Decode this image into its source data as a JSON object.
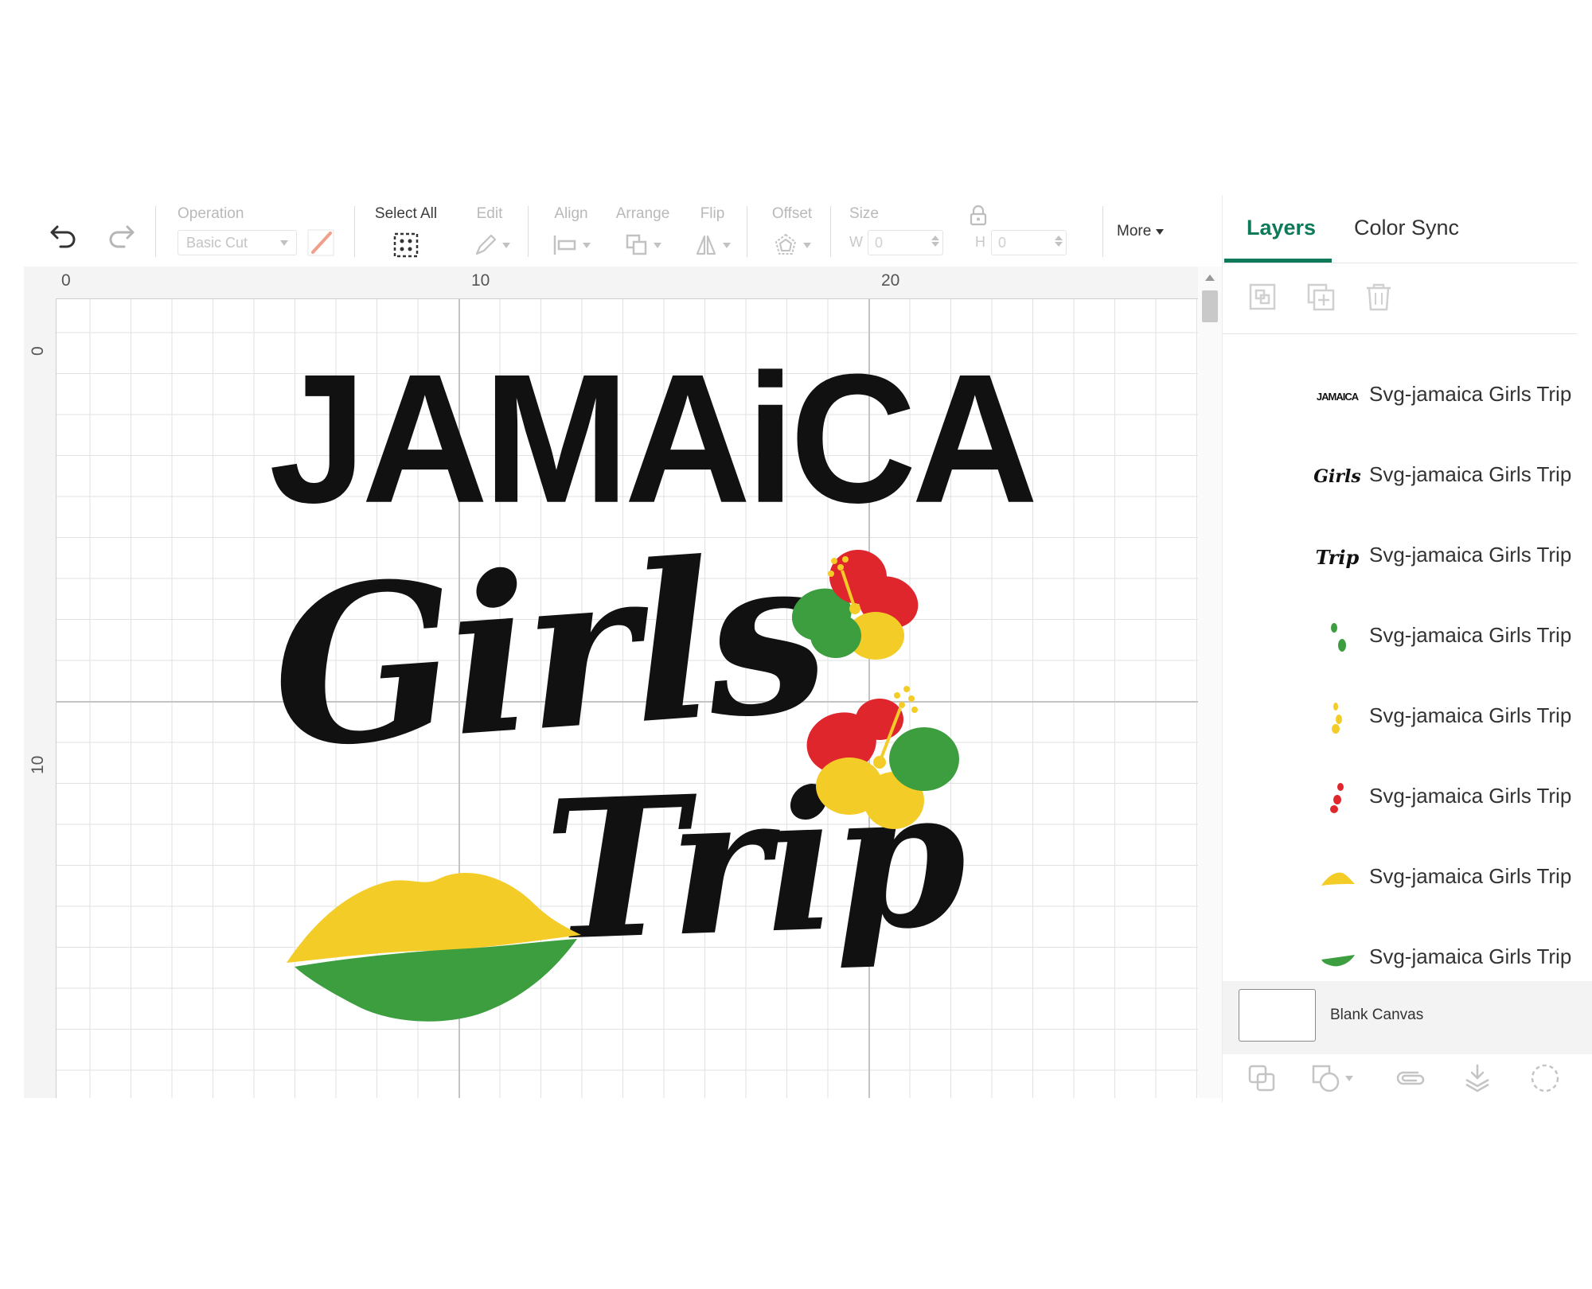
{
  "toolbar": {
    "undo_icon": "undo-icon",
    "redo_icon": "redo-icon",
    "operation": {
      "label": "Operation",
      "value": "Basic Cut",
      "pen_color": "#f0a089"
    },
    "select_all": {
      "label": "Select All",
      "icon": "select-all-icon"
    },
    "edit": {
      "label": "Edit",
      "icon": "pencil-icon"
    },
    "align": {
      "label": "Align",
      "icon": "align-icon"
    },
    "arrange": {
      "label": "Arrange",
      "icon": "arrange-icon"
    },
    "flip": {
      "label": "Flip",
      "icon": "flip-icon"
    },
    "offset": {
      "label": "Offset",
      "icon": "offset-icon"
    },
    "size": {
      "label": "Size",
      "w_label": "W",
      "w_value": "0",
      "h_label": "H",
      "h_value": "0",
      "lock_icon": "lock-icon"
    },
    "more": {
      "label": "More"
    }
  },
  "rulers": {
    "top": [
      "0",
      "10",
      "20"
    ],
    "left": [
      "0",
      "10"
    ]
  },
  "canvas": {
    "title_text": "JAMAiCA",
    "girls_text": "Girls",
    "trip_text": "Trip",
    "colors": {
      "yellow": "#f4cc27",
      "green": "#3d9e3f",
      "red": "#e0262d",
      "black": "#111111"
    }
  },
  "panel": {
    "tabs": [
      {
        "label": "Layers",
        "active": true
      },
      {
        "label": "Color Sync",
        "active": false
      }
    ],
    "tools": [
      "group-icon",
      "duplicate-icon",
      "delete-icon"
    ],
    "layers": [
      {
        "name": "Svg-jamaica Girls Trip",
        "thumb": "jamaica-text-thumb",
        "thumb_text": "JAMAICA"
      },
      {
        "name": "Svg-jamaica Girls Trip",
        "thumb": "girls-text-thumb",
        "thumb_text": "Girls"
      },
      {
        "name": "Svg-jamaica Girls Trip",
        "thumb": "trip-text-thumb",
        "thumb_text": "Trip"
      },
      {
        "name": "Svg-jamaica Girls Trip",
        "thumb": "green-petals-thumb"
      },
      {
        "name": "Svg-jamaica Girls Trip",
        "thumb": "yellow-petals-thumb"
      },
      {
        "name": "Svg-jamaica Girls Trip",
        "thumb": "red-petals-thumb"
      },
      {
        "name": "Svg-jamaica Girls Trip",
        "thumb": "yellow-lip-thumb"
      },
      {
        "name": "Svg-jamaica Girls Trip",
        "thumb": "green-lip-thumb"
      }
    ],
    "blank_canvas_label": "Blank Canvas",
    "bottom_tools": [
      "slice-icon",
      "combine-icon",
      "attach-icon",
      "flatten-icon",
      "contour-icon"
    ]
  }
}
